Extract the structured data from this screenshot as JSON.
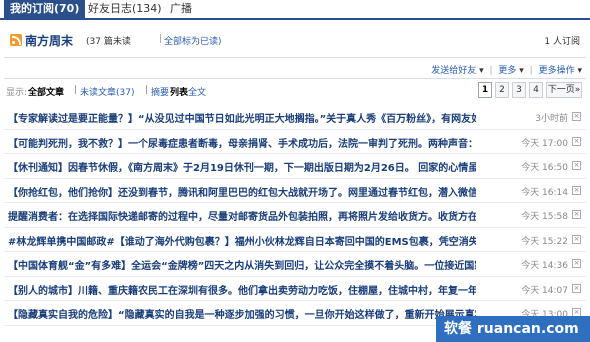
{
  "tabs": [
    {
      "label": "我的订阅(70)",
      "active": true
    },
    {
      "label": "好友日志(134)",
      "active": false
    },
    {
      "label": "广播",
      "active": false
    }
  ],
  "feed": {
    "title": "南方周末",
    "unread_count": "(37",
    "unread_label": "篇未读",
    "separator": "|",
    "mark_all_read": "全部标为已读)",
    "subscribers": "1 人订阅"
  },
  "actions": {
    "send_to_friend": "发送给好友",
    "more": "更多",
    "more_ops": "更多操作"
  },
  "filter": {
    "show_label": "显示:",
    "all_articles": "全部文章",
    "unread_articles": "未读文章(37)",
    "bar": "|",
    "summary": "摘要",
    "list": "列表",
    "fulltext": "全文"
  },
  "pager": {
    "pages": [
      "1",
      "2",
      "3",
      "4"
    ],
    "current": "1",
    "next": "下一页»"
  },
  "articles": [
    {
      "title": "【专家解读过是要正能量？】“从没见过中国节日如此光明正大地搁指。”关于真人秀《百万粉丝》，有网友如此评论。",
      "time": "3小时前"
    },
    {
      "title": "【可能判死刑，我不救？】一个尿毒症患者断毒，母亲捐肾、手术成功后，法院一审判了死刑。两种声音：先救再杀。",
      "time": "今天 17:00"
    },
    {
      "title": "【休刊通知】因春节休假，《南方周末》于2月19日休刊一期，下一期出版日期为2月26日。 回家的心情虽然迫切，",
      "time": "今天 16:50"
    },
    {
      "title": "【你抢红包，他们抢你】还没到春节，腾讯和阿里巴巴的红包大战就开场了。网里通过春节红包，潜入微信生态圈，而",
      "time": "今天 16:14"
    },
    {
      "title": "提醒消费者：在选择国际快递邮寄的过程中，尽量对邮寄货品外包装拍照，再将照片发给收货方。收货方在收取包裹",
      "time": "今天 15:58"
    },
    {
      "title": "#林龙辉单携中国邮政#【谁动了海外代购包裹？】福州小伙林龙辉自日本寄回中国的EMS包裹，凭空消失了价值",
      "time": "今天 15:22"
    },
    {
      "title": "【中国体育舰“金”有多难】全运会“金牌榜”四天之内从消失到回归，让公众完全摸不着头脑。一位接近国家体育总局",
      "time": "今天 14:36"
    },
    {
      "title": "【别人的城市】川籍、重庆籍农民工在深圳有很多。他们拿出卖劳动力吃饭，住棚屋，住城中村，年复一年，至今未",
      "time": "今天 14:07"
    },
    {
      "title": "【隐藏真实自我的危险】“隐藏真实的自我是一种逐步加强的习惯，一旦你开始这样做了，重新开始展示真实",
      "time": "今天 13:00"
    }
  ],
  "watermark": "软餐 ruancan.com"
}
